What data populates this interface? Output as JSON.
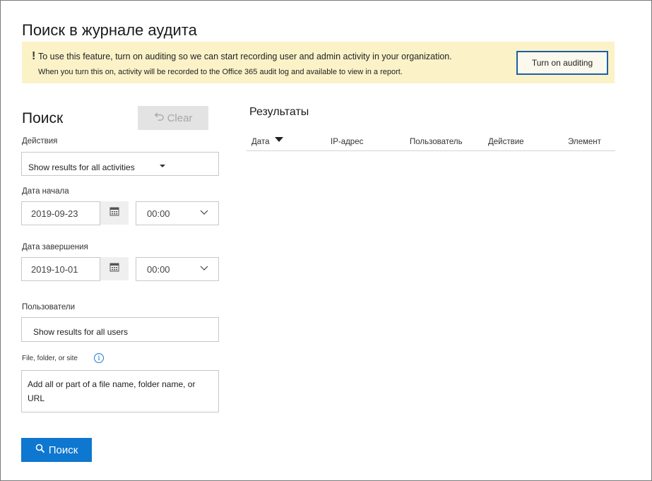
{
  "page": {
    "title": "Поиск в журнале аудита"
  },
  "banner": {
    "bang": "!",
    "line1": "To use this feature, turn on auditing so we can start recording user and admin activity in your organization.",
    "line2": "When you turn this on, activity will be recorded to the Office 365 audit log and available to view in a report.",
    "button_label": "Turn on auditing",
    "background_color": "#fcf2c8"
  },
  "search_panel": {
    "heading": "Поиск",
    "clear_label": "Clear",
    "activities_label": "Действия",
    "activities_value": "Show results for all activities",
    "start_date_label": "Дата начала",
    "start_date_value": "2019-09-23",
    "start_time_value": "00:00",
    "end_date_label": "Дата завершения",
    "end_date_value": "2019-10-01",
    "end_time_value": "00:00",
    "users_label": "Пользователи",
    "users_value": "Show results for all users",
    "file_label": "File, folder, or site",
    "file_placeholder": "Add all or part of a file name, folder name, or URL",
    "search_button_label": "Поиск",
    "accent_color": "#0e77cf"
  },
  "results": {
    "heading": "Результаты",
    "columns": [
      "Дата",
      "IP-адрес",
      "Пользователь",
      "Действие",
      "Элемент"
    ]
  }
}
